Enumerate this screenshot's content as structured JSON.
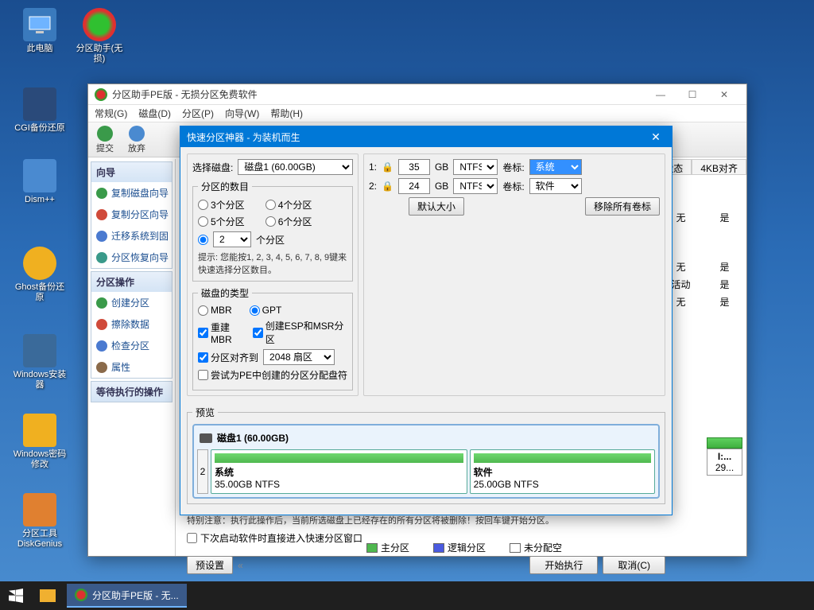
{
  "desktop": {
    "icons": [
      {
        "label": "此电脑"
      },
      {
        "label": "分区助手(无损)"
      },
      {
        "label": "CGI备份还原"
      },
      {
        "label": "Dism++"
      },
      {
        "label": "Ghost备份还原"
      },
      {
        "label": "Windows安装器"
      },
      {
        "label": "Windows密码修改"
      },
      {
        "label": "分区工具DiskGenius"
      }
    ]
  },
  "main_window": {
    "title": "分区助手PE版 - 无损分区免费软件",
    "menu": [
      "常规(G)",
      "磁盘(D)",
      "分区(P)",
      "向导(W)",
      "帮助(H)"
    ],
    "toolbar": [
      {
        "label": "提交"
      },
      {
        "label": "放弃"
      }
    ],
    "columns": [
      "状态",
      "4KB对齐"
    ],
    "rows": [
      [
        "无",
        "是"
      ],
      [
        "无",
        "是"
      ],
      [
        "活动",
        "是"
      ],
      [
        "无",
        "是"
      ]
    ],
    "wizard": {
      "title": "向导",
      "items": [
        "复制磁盘向导",
        "复制分区向导",
        "迁移系统到固",
        "分区恢复向导"
      ]
    },
    "ops": {
      "title": "分区操作",
      "items": [
        "创建分区",
        "擦除数据",
        "检查分区",
        "属性"
      ]
    },
    "pending": {
      "title": "等待执行的操作"
    },
    "disk_small": {
      "label": "I:...",
      "size": "29..."
    },
    "legend": {
      "primary": "主分区",
      "logical": "逻辑分区",
      "unalloc": "未分配空"
    }
  },
  "dialog": {
    "title": "快速分区神器 - 为装机而生",
    "select_disk_label": "选择磁盘:",
    "select_disk_value": "磁盘1 (60.00GB)",
    "count_group": "分区的数目",
    "count_opts": [
      "3个分区",
      "4个分区",
      "5个分区",
      "6个分区"
    ],
    "count_custom_val": "2",
    "count_custom_suffix": "个分区",
    "count_hint": "提示: 您能按1, 2, 3, 4, 5, 6, 7, 8, 9键来快速选择分区数目。",
    "type_group": "磁盘的类型",
    "type_mbr": "MBR",
    "type_gpt": "GPT",
    "rebuild_mbr": "重建MBR",
    "create_esp": "创建ESP和MSR分区",
    "align_label": "分区对齐到",
    "align_value": "2048 扇区",
    "try_pe": "尝试为PE中创建的分区分配盘符",
    "rows": [
      {
        "idx": "1:",
        "size": "35",
        "unit": "GB",
        "fs": "NTFS",
        "vol_label": "卷标:",
        "vol": "系统",
        "hl": true
      },
      {
        "idx": "2:",
        "size": "24",
        "unit": "GB",
        "fs": "NTFS",
        "vol_label": "卷标:",
        "vol": "软件",
        "hl": false
      }
    ],
    "default_size_btn": "默认大小",
    "remove_labels_btn": "移除所有卷标",
    "preview_group": "预览",
    "preview_disk": "磁盘1  (60.00GB)",
    "preview_num": "2",
    "preview_parts": [
      {
        "name": "系统",
        "detail": "35.00GB NTFS"
      },
      {
        "name": "软件",
        "detail": "25.00GB NTFS"
      }
    ],
    "warning": "特别注意：执行此操作后，当前所选磁盘上已经存在的所有分区将被删除！按回车键开始分区。",
    "next_launch": "下次启动软件时直接进入快速分区窗口",
    "preset_btn": "预设置",
    "start_btn": "开始执行",
    "cancel_btn": "取消(C)"
  },
  "taskbar": {
    "task": "分区助手PE版 - 无..."
  }
}
